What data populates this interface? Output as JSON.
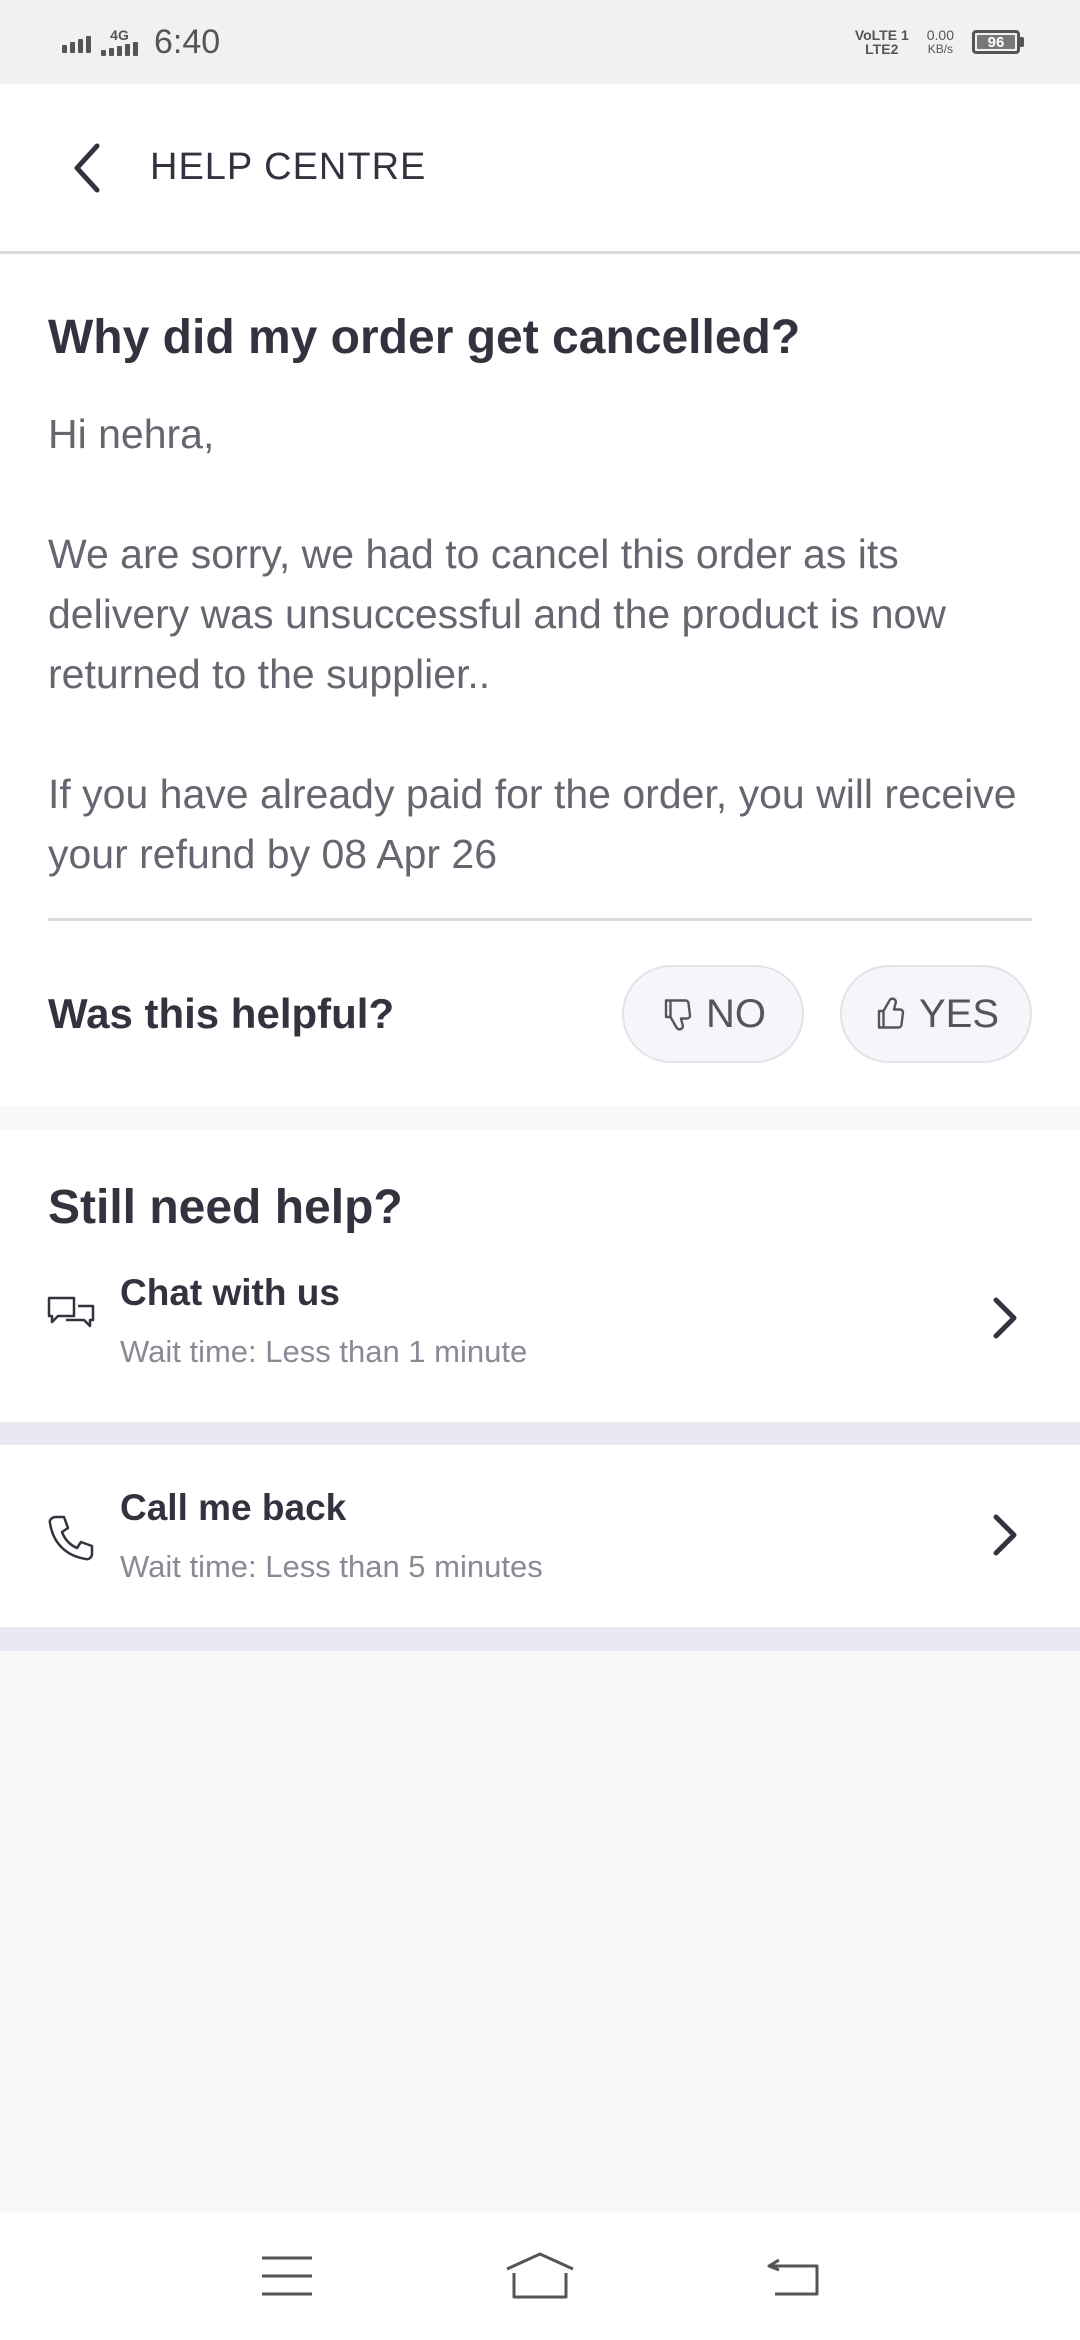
{
  "status_bar": {
    "network": "4G",
    "time": "6:40",
    "volte_line1": "VoLTE 1",
    "volte_line2": "LTE2",
    "speed_value": "0.00",
    "speed_unit": "KB/s",
    "battery": "96"
  },
  "header": {
    "title": "HELP CENTRE"
  },
  "article": {
    "title": "Why did my order get cancelled?",
    "greeting": "Hi nehra,",
    "paragraph1": "We are sorry, we had to cancel this order as its delivery was unsuccessful and the product is now returned to the supplier..",
    "paragraph2": "If you have already paid for the order, you will receive your refund by 08 Apr 26"
  },
  "feedback": {
    "question": "Was this helpful?",
    "no_label": "NO",
    "yes_label": "YES"
  },
  "support": {
    "title": "Still need help?",
    "chat": {
      "title": "Chat with us",
      "subtitle": "Wait time: Less than 1 minute"
    },
    "call": {
      "title": "Call me back",
      "subtitle": "Wait time: Less than 5 minutes"
    }
  },
  "colors": {
    "text_primary": "#333340",
    "text_secondary": "#666670",
    "text_muted": "#8a8a96",
    "divider": "#d9d9df",
    "band": "#e9e9f1"
  }
}
